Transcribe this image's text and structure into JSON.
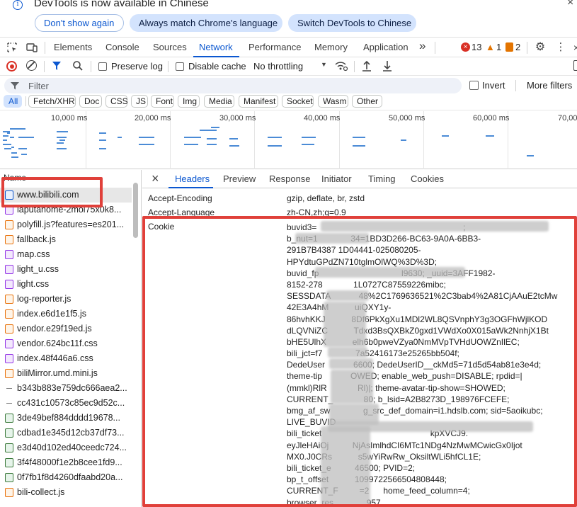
{
  "infobar": {
    "message": "DevTools is now available in Chinese",
    "close_symbol": "×",
    "btn_dont_show": "Don't show again",
    "btn_match": "Always match Chrome's language",
    "btn_switch": "Switch DevTools to Chinese"
  },
  "main_tabs": [
    "Elements",
    "Console",
    "Sources",
    "Network",
    "Performance",
    "Memory",
    "Application"
  ],
  "active_tab": "Network",
  "more_tabs_symbol": "»",
  "status": {
    "errors": "13",
    "warnings": "1",
    "issues": "2"
  },
  "network_toolbar": {
    "preserve_log": "Preserve log",
    "disable_cache": "Disable cache",
    "throttling": "No throttling"
  },
  "filter": {
    "placeholder": "Filter",
    "invert": "Invert",
    "more_filters": "More filters"
  },
  "type_chips": [
    "All",
    "Fetch/XHR",
    "Doc",
    "CSS",
    "JS",
    "Font",
    "Img",
    "Media",
    "Manifest",
    "Socket",
    "Wasm",
    "Other"
  ],
  "timeline_labels": [
    "10,000 ms",
    "20,000 ms",
    "30,000 ms",
    "40,000 ms",
    "50,000 ms",
    "60,000 ms",
    "70,000"
  ],
  "request_list": {
    "header": "Name",
    "items": [
      {
        "name": "www.bilibili.com",
        "type": "doc"
      },
      {
        "name": "laputahome-2mol75x0k8...",
        "type": "css"
      },
      {
        "name": "polyfill.js?features=es201...",
        "type": "js"
      },
      {
        "name": "fallback.js",
        "type": "js"
      },
      {
        "name": "map.css",
        "type": "css"
      },
      {
        "name": "light_u.css",
        "type": "css"
      },
      {
        "name": "light.css",
        "type": "css"
      },
      {
        "name": "log-reporter.js",
        "type": "js"
      },
      {
        "name": "index.e6d1e1f5.js",
        "type": "js"
      },
      {
        "name": "vendor.e29f19ed.js",
        "type": "js"
      },
      {
        "name": "vendor.624bc11f.css",
        "type": "css"
      },
      {
        "name": "index.48f446a6.css",
        "type": "css"
      },
      {
        "name": "biliMirror.umd.mini.js",
        "type": "js"
      },
      {
        "name": "b343b883e759dc666aea2...",
        "type": "dash"
      },
      {
        "name": "cc431c10573c85ec9d52c...",
        "type": "dash"
      },
      {
        "name": "3de49bef884dddd19678...",
        "type": "img"
      },
      {
        "name": "cdbad1e345d12cb37df73...",
        "type": "img"
      },
      {
        "name": "e3d40d102ed40ceedc724...",
        "type": "img"
      },
      {
        "name": "3f4f48000f1e2b8cee1fd9...",
        "type": "img"
      },
      {
        "name": "0f7fb1f8d4260dfaabd20a...",
        "type": "img"
      },
      {
        "name": "bili-collect.js",
        "type": "js"
      }
    ]
  },
  "detail": {
    "close_symbol": "×",
    "tabs": [
      "Headers",
      "Preview",
      "Response",
      "Initiator",
      "Timing",
      "Cookies"
    ],
    "active_tab": "Headers",
    "headers": [
      {
        "name": "Accept-Encoding",
        "value": "gzip, deflate, br, zstd"
      },
      {
        "name": "Accept-Language",
        "value": "zh-CN,zh;q=0.9"
      },
      {
        "name": "Cookie",
        "value": ""
      }
    ],
    "cookie_lines": [
      "buvid3=                                                              ;",
      "b_nut=1              34=1BD3D266-BC63-9A0A-6BB3-",
      "291B7B4387 1D04441-025080205-",
      "HPYdtuGPdZN710tglmOlWQ%3D%3D;",
      "buvid_fp                                   l9630; _uuid=3AFF1982-",
      "8152-278             1L0727C87559226mibc;",
      "SESSDATA            48%2C1769636521%2C3bab4%2A81CjAAuE2tcMw",
      "42E3A4hM           uiQXY1y-",
      "86hvhKKJ           8Df6PkXgXu1MDl2WL8QSVnphY3g3OGFhWjlKOD",
      "dLQVNiZC           Tdxd3BsQXBkZ0gxd1VWdXo0X015aWk2NnhjX1Bt",
      "bHE5UlhX           elh6b0pweVZya0NmMVpTVHdUOWZnIlEC;",
      "bili_jct=f7              7a52416173e25265bb504f;",
      "DedeUser            6600; DedeUserID__ckMd5=71d5d54ab81e3e4d;",
      "theme-tip            OWED; enable_web_push=DISABLE; rpdid=|",
      "(mmkl)RlR             Rl)|; theme-avatar-tip-show=SHOWED;",
      "CURRENT_             80; b_lsid=A2B8273D_198976FCEFE;",
      "bmg_af_sw              g_src_def_domain=i1.hdslb.com; sid=5aoikubc;",
      "LIVE_BUVID",
      "bili_ticket                                              kpXVCJ9.",
      "eyJleHAiOj          NjAsImlhdCI6MTc1NDg4NzMwMCwicGx0Ijot",
      "MX0.J0CRs           s5wYiRwRw_OksiltWLi5hfCL1E;",
      "bili_ticket_e          46500; PVID=2;",
      "bp_t_offset           1099722566504808448;",
      "CURRENT_F         =2      home_feed_column=4;",
      "browser_res              957"
    ]
  }
}
